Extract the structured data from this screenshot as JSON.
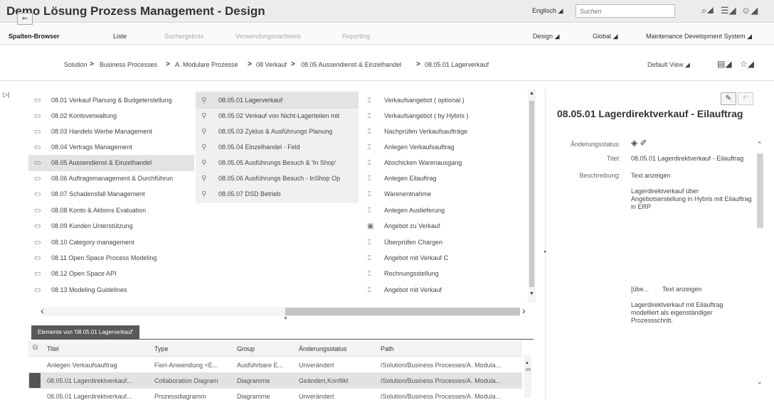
{
  "header": {
    "title": "Demo Lösung Prozess Management - Design",
    "language": "Englisch",
    "search_placeholder": "Suchen",
    "icons": [
      "binoculars-icon",
      "list-icon",
      "user-icon"
    ]
  },
  "nav": {
    "left": [
      "Spalten-Browser",
      "Liste",
      "Suchergebnis",
      "Verwendungsnachweis",
      "Reporting"
    ],
    "right": [
      "Design",
      "Global",
      "Maintenance Development System"
    ]
  },
  "breadcrumb": {
    "items": [
      "Solution",
      "Business Processes",
      "A. Modulare Prozesse",
      "08 Verkauf",
      "08.05 Aussendienst & Einzelhandel",
      "08.05.01 Lagerverkauf"
    ],
    "sep": ">",
    "view": "Default View"
  },
  "columns": {
    "col1": [
      "08.01 Verkauf Planung & Budgeterstellung",
      "08.02 Kontoverwaltung",
      "08.03 Handels Werbe Management",
      "08.04 Vertrags Management",
      "08.05 Aussendienst & Einzelhandel",
      "08.06 Auftragsmanagement & Durchführun",
      "08.07 Schadensfall Management",
      "08.08 Konto & Aktions Evaluation",
      "08.09 Kunden Unterstützung",
      "08.10 Category management",
      "08.11 Open Space Process Modeling",
      "08.12 Open Space API",
      "08.13 Modeling Guidelines"
    ],
    "col2": [
      "08.05.01 Lagerverkauf",
      "08.05.02 Verkauf von Nicht-Lagerteilen mit",
      "08.05.03 Zyklus & Ausführungs Planung",
      "08.05.04 Einzelhandel - Feld",
      "08.05.05 Ausführungs Besuch & 'In Shop'",
      "08.05.06 Ausführungs Besuch - InShop Op",
      "08.05.07 DSD Betrieb"
    ],
    "col3": [
      "Verkaufsangebot ( optional )",
      "Verkaufsangebot ( by Hybris )",
      "Nachprüfen Verkaufsaufträge",
      "Anlegen Verkaufsauftrag",
      "Abschicken Warenausgang",
      "Anlegen Eilauftrag",
      "Warenentnahme",
      "Anlegen Auslieferung",
      "Angebot zu Verkauf",
      "Überprüfen Chargen",
      "Angebot mit Verkauf C",
      "Rechnungsstellung",
      "Angebot mit Verkauf"
    ]
  },
  "elements": {
    "tab_label": "Elemente von '08.05.01 Lagerverkauf'",
    "headers": [
      "Titel",
      "Type",
      "Group",
      "Änderungsstatus",
      "Path"
    ],
    "rows": [
      [
        "Anlegen Verkaufsauftrag",
        "Fiori-Anwendung <E...",
        "Ausführbare E...",
        "Unverändert",
        "/Solution/Business Processes/A. Modula..."
      ],
      [
        "08.05.01 Lagerdirektverkauf...",
        "Collaboration Diagram",
        "Diagramme",
        "Geändert,Konflikt",
        "/Solution/Business Processes/A. Modula..."
      ],
      [
        "08.05.01 Lagerdirektverkauf...",
        "Prozessdiagramm",
        "Diagramme",
        "Unverändert",
        "/Solution/Business Processes/A. Modula..."
      ]
    ]
  },
  "detail": {
    "title": "08.05.01 Lagerdirektverkauf - Eilauftrag",
    "status_label": "Änderungsstatus:",
    "titel_label": "Titel:",
    "titel_value": "08.05.01 Lagerdirektverkauf - Eilauftrag",
    "beschreibung_label": "Beschreibung:",
    "beschreibung_link": "Text anzeigen",
    "beschreibung_text": "Lagerdirektverkauf über Angebotserstellung in Hybris mit Eilauftrag in ERP",
    "ube_label": "[übe...",
    "ube_link": "Text anzeigen",
    "ube_text": "Lagerdirektverkauf mit Eilauftrag modelliert als eigenständiger Prozessschritt."
  }
}
